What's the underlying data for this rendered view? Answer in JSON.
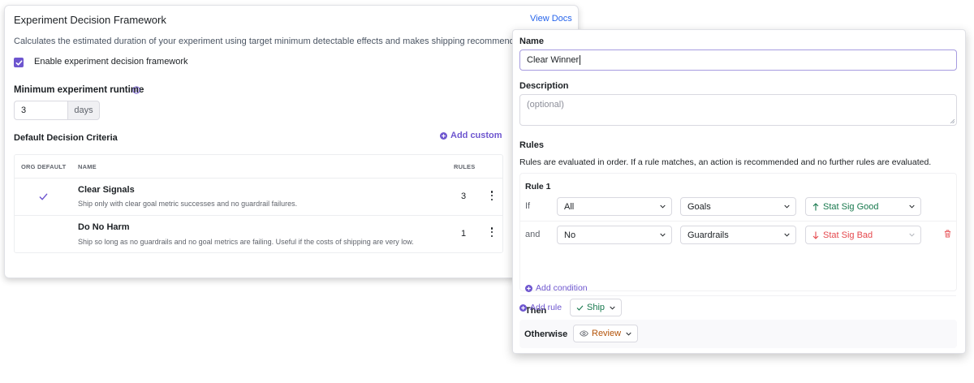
{
  "framework": {
    "title": "Experiment Decision Framework",
    "docs_link": "View Docs",
    "description": "Calculates the estimated duration of your experiment using target minimum detectable effects and makes shipping recommendations.",
    "enable_label": "Enable experiment decision framework",
    "enable_checked": true,
    "runtime_label": "Minimum experiment runtime",
    "runtime_value": "3",
    "runtime_unit": "days",
    "criteria_title": "Default Decision Criteria",
    "add_custom": "Add custom",
    "table": {
      "headers": [
        "ORG DEFAULT",
        "NAME",
        "RULES"
      ],
      "rows": [
        {
          "is_default": true,
          "name": "Clear Signals",
          "description": "Ship only with clear goal metric successes and no guardrail failures.",
          "rules": "3"
        },
        {
          "is_default": false,
          "name": "Do No Harm",
          "description": "Ship so long as no guardrails and no goal metrics are failing. Useful if the costs of shipping are very low.",
          "rules": "1"
        }
      ]
    }
  },
  "editor": {
    "name_label": "Name",
    "name_value": "Clear Winner",
    "description_label": "Description",
    "description_placeholder": "(optional)",
    "rules_label": "Rules",
    "rules_help": "Rules are evaluated in order. If a rule matches, an action is recommended and no further rules are evaluated.",
    "rule": {
      "title": "Rule 1",
      "conditions": [
        {
          "word": "If",
          "match": "All",
          "metric": "Goals",
          "direction": "up",
          "result": "Stat Sig Good",
          "result_color": "#18794e"
        },
        {
          "word": "and",
          "match": "No",
          "metric": "Guardrails",
          "direction": "down",
          "result": "Stat Sig Bad",
          "result_color": "#e5484d"
        }
      ],
      "add_condition": "Add condition",
      "then_label": "Then",
      "action": "Ship"
    },
    "add_rule": "Add rule",
    "otherwise_label": "Otherwise",
    "otherwise_action": "Review"
  },
  "colors": {
    "accent": "#6e56cf",
    "link": "#2563eb",
    "good": "#18794e",
    "bad": "#e5484d",
    "review": "#b45309"
  },
  "icons": [
    "check-icon",
    "info-icon",
    "plus-circle-icon",
    "kebab-menu-icon",
    "chevron-down-icon",
    "arrow-up-icon",
    "arrow-down-icon",
    "trash-icon",
    "eye-icon"
  ]
}
